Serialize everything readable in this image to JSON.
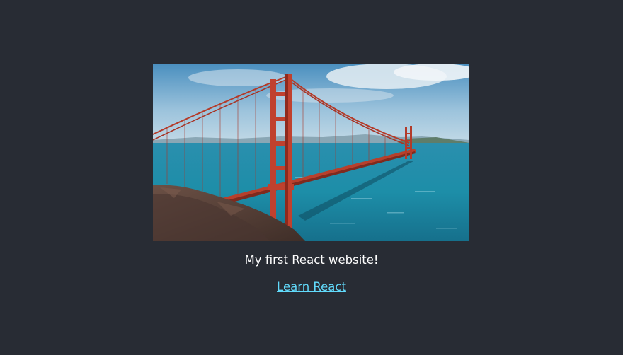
{
  "page": {
    "background": "#282c34",
    "hero_image": {
      "alt": "Golden Gate Bridge",
      "icon": "bridge-photo"
    },
    "caption": "My first React website!",
    "link": {
      "label": "Learn React",
      "color": "#61dafb"
    }
  }
}
